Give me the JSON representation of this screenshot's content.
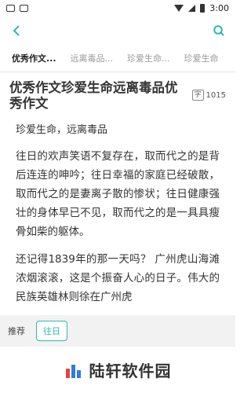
{
  "status_bar": {
    "time": "3:00"
  },
  "tabs": [
    {
      "label": "优秀作文...",
      "active": true
    },
    {
      "label": "远离毒品...",
      "active": false
    },
    {
      "label": "珍爱生命...",
      "active": false
    },
    {
      "label": "珍爱生命",
      "active": false
    }
  ],
  "article": {
    "title": "优秀作文珍爱生命远离毒品优秀作文",
    "word_count_badge": "字",
    "word_count": "1015",
    "subtitle": "珍爱生命，远离毒品",
    "paragraphs": [
      "往日的欢声笑语不复存在，取而代之的是背后连连的呻吟；往日幸福的家庭已经破散，取而代之的是妻离子散的惨状；往日健康强壮的身体早已不见，取而代之的是一具具瘦骨如柴的躯体。",
      "还记得1839年的那一天吗？ 广州虎山海滩浓烟滚滚，这是个振奋人心的日子。伟大的民族英雄林则徐在广州虎"
    ]
  },
  "bottom_bar": {
    "label": "推荐",
    "chip": "往日"
  },
  "watermark": {
    "text": "陆轩软件园"
  },
  "colors": {
    "accent": "#2fb8b0"
  }
}
